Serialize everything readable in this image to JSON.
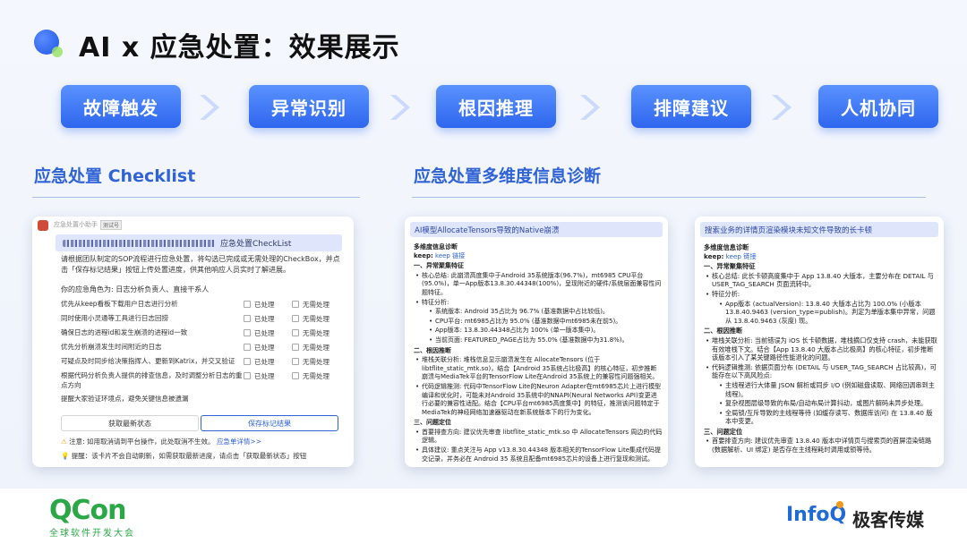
{
  "slide": {
    "title": "AI x 应急处置：效果展示",
    "steps": [
      "故障触发",
      "异常识别",
      "根因推理",
      "排障建议",
      "人机协同"
    ],
    "left_section_title": "应急处置 Checklist",
    "right_section_title": "应急处置多维度信息诊断"
  },
  "checklist_card": {
    "app_name": "应急处置小助手",
    "app_badge": "测试号",
    "banner_suffix": "应急处置CheckList",
    "intro": "请根据团队制定的SOP流程进行应急处置，将勾选已完成或无需处理的CheckBox，并点击「保存标记结果」按钮上传处置进度，供其他响应人员实时了解进展。",
    "role_line": "你的应急角色为: 日志分析负责人、直接干系人",
    "option_done": "已处理",
    "option_skip": "无需处理",
    "items": [
      "优先从keep看板下载用户日志进行分析",
      "同时使用小灵通等工具进行日志回捞",
      "确保日志的进程id和发生崩溃的进程id一致",
      "优先分析崩溃发生时间附近的日志",
      "可疑点及时同步给决策指挥人、更新到Katrix，并交叉验证",
      "根据代码分析负责人提供的排查信息，及时调整分析日志的重点方向",
      "提醒大家验证环境点，避免关键信息被遗漏"
    ],
    "btn_refresh": "获取最新状态",
    "btn_save": "保存标记结果",
    "note_warning": "注意: 如用取消请到平台操作，此处取消不生效。",
    "note_warning_link": "应急单详情>>",
    "note_tip": "提醒：该卡片不会自动刷新，如需获取最新进度，请点击「获取最新状态」按钮"
  },
  "diag_card_1": {
    "header": "AI模型AllocateTensors导致的Native崩溃",
    "section_title": "多维度信息诊断",
    "keep_label": "keep:",
    "keep_link": "keep 链接",
    "s1": "一、异常聚集特征",
    "s1_core": "核心总结: 此崩溃高度集中于Android 35系统版本(96.7%)，mt6985 CPU平台(95.0%)，单一App版本13.8.30.44348(100%)，呈现附近的硬件/系统层面兼容性问题特征。",
    "s1_feat": "特征分析:",
    "s1_f1": "系统版本: Android 35占比为 96.7% (基准数据中占比较低)。",
    "s1_f2": "CPU平台: mt6985占比为 95.0% (基准数据中mt6985未在前5)。",
    "s1_f3": "App版本: 13.8.30.44348占比为 100% (单一版本集中)。",
    "s1_f4": "当前页面: FEATURED_PAGE占比为 55.0% (基准数据中为31.8%)。",
    "s2": "二、根因推断",
    "s2_stack": "堆栈关联分析: 堆栈信息显示崩溃发生在 AllocateTensors (位于 libtflite_static_mtk.so)，结合【Android 35系统占比极高】的核心特征，初步推断崩溃与MediaTek平台的TensorFlow Lite在Android 35系统上的兼容性问题强相关。",
    "s2_code": "代码逻辑推测: 代码中TensorFlow Lite的Neuron Adapter在mt6985芯片上进行模型编译和优化时，可能未对Android 35系统中的NNAPI(Neural Networks API)变更进行必要的兼容性适配。结合【CPU平台mt6985高度集中】的特征，推测该问题特定于MediaTek的神经网络加速器驱动在新系统版本下的行为变化。",
    "s3": "三、问题定位",
    "s3_dir": "首要排查方向: 建议优先审查 libtflite_static_mtk.so 中 AllocateTensors 周边的代码逻辑。",
    "s3_sug": "具体建议: 重点关注与 App v13.8.30.44348 版本相关的TensorFlow Lite集成代码提交记录，并务必在 Android 35 系统且配备mt6985芯片的设备上进行复现和测试。"
  },
  "diag_card_2": {
    "header": "搜索业务的详情页渲染模块未知文件导致的长卡顿",
    "section_title": "多维度信息诊断",
    "keep_label": "keep:",
    "keep_link": "keep 链接",
    "s1": "一、异常聚集特征",
    "s1_core": "核心总结: 此长卡顿高度集中于 App 13.8.40 大版本，主要分布在 DETAIL 与 USER_TAG_SEARCH 页面流转中。",
    "s1_feat": "特征分析:",
    "s1_f1": "App版本 (actualVersion): 13.8.40 大版本占比为 100.0% (小版本 13.8.40.9463 (version_type=publish)。判定为单版本集中异常，问题从 13.8.40.9463 (灰度) 现。",
    "s2": "二、根因推断",
    "s2_stack": "堆栈关联分析: 当前错误为 iOS 长卡顿数据，堆栈摘口仅支持 crash，未能获取有效堆栈下文。结合【App 13.8.40 大版本占比极高】的核心特征，初步推断该版本引入了某关键路径性能退化的问题。",
    "s2_code": "代码逻辑推测: 依据页面分布 (DETAIL 与 USER_TAG_SEARCH 占比较高)，可能存在以下高风险点:",
    "s2_c1": "主线程进行大体量 JSON 解析或同步 I/O (例如磁盘读取、网络回调串到主线程)。",
    "s2_c2": "复杂视图层级导致的布局/自动布局计算抖动，或图片解码未异步处理。",
    "s2_c3": "全局锁/互斥导致的主线程等待 (如缓存读写、数据库访问) 在 13.8.40 版本中变更。",
    "s3": "三、问题定位",
    "s3_dir": "首要排查方向: 建议优先审查 13.8.40 版本中详情页与搜索页的首屏渲染链路 (数据解析、UI 绑定) 是否存在主线程耗时调用或锁等待。"
  },
  "footer": {
    "qcon": "QCon",
    "qcon_sub": "全球软件开发大会",
    "infoq": "InfoQ",
    "infoq_cn": "极客传媒"
  },
  "colors": {
    "accent": "#2f63d6",
    "step_bg": "#3a74f5",
    "qcon_green": "#2aa845"
  },
  "icons": [
    "arrow-right-icon",
    "warning-icon",
    "bulb-icon",
    "app-logo-icon"
  ]
}
